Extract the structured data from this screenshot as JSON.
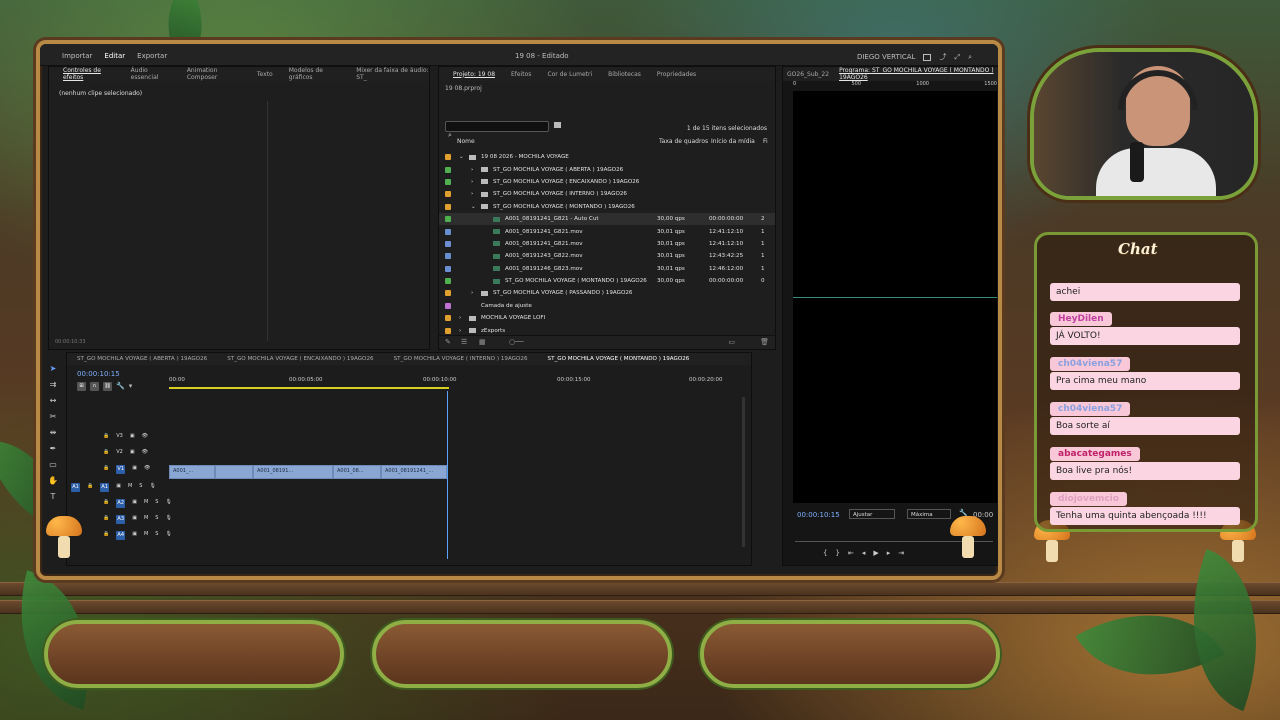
{
  "editor": {
    "menu": [
      "Importar",
      "Editar",
      "Exportar"
    ],
    "active_menu": "Editar",
    "title": "19 08 - Editado",
    "workspace": "DIEGO VERTICAL"
  },
  "effect_controls": {
    "tabs": [
      "Controles de efeitos",
      "Áudio essencial",
      "Animation Composer",
      "Texto",
      "Modelos de gráficos",
      "Mixer da faixa de áudio: ST_"
    ],
    "empty_text": "(nenhum clipe selecionado)",
    "timecode": "00:00:10:33"
  },
  "project": {
    "tabs": [
      "Projeto: 19 08",
      "Efeitos",
      "Cor de Lumetri",
      "Bibliotecas",
      "Propriedades"
    ],
    "file": "19 08.prproj",
    "count": "1 de 15 itens selecionados",
    "columns": [
      "Nome",
      "Taxa de quadros",
      "Início da mídia",
      "Fi"
    ],
    "rows": [
      {
        "name": "19 08 2026 - MOCHILA VOYAGE",
        "indent": 1,
        "kind": "folder-open",
        "color": "#e0a030",
        "fps": "",
        "start": "",
        "f": ""
      },
      {
        "name": "ST_GO MOCHILA VOYAGE ( ABERTA ) 19AGO26",
        "indent": 2,
        "kind": "folder",
        "color": "#50b050",
        "fps": "",
        "start": "",
        "f": ""
      },
      {
        "name": "ST_GO MOCHILA VOYAGE ( ENCAIXANDO ) 19AGO26",
        "indent": 2,
        "kind": "folder",
        "color": "#50b050",
        "fps": "",
        "start": "",
        "f": ""
      },
      {
        "name": "ST_GO MOCHILA VOYAGE ( INTERNO ) 19AGO26",
        "indent": 2,
        "kind": "folder",
        "color": "#e0a030",
        "fps": "",
        "start": "",
        "f": ""
      },
      {
        "name": "ST_GO MOCHILA VOYAGE ( MONTANDO ) 19AGO26",
        "indent": 2,
        "kind": "folder-open",
        "color": "#e0a030",
        "fps": "",
        "start": "",
        "f": ""
      },
      {
        "name": "A001_08191241_G821 - Auto Cut",
        "indent": 3,
        "kind": "seq",
        "color": "#50b050",
        "fps": "30,00 qps",
        "start": "00:00:00:00",
        "f": "2",
        "sel": true
      },
      {
        "name": "A001_08191241_G821.mov",
        "indent": 3,
        "kind": "clip",
        "color": "#6b8fd0",
        "fps": "30,01 qps",
        "start": "12:41:12:10",
        "f": "1"
      },
      {
        "name": "A001_08191241_G821.mov",
        "indent": 3,
        "kind": "clip",
        "color": "#6b8fd0",
        "fps": "30,01 qps",
        "start": "12:41:12:10",
        "f": "1"
      },
      {
        "name": "A001_08191243_G822.mov",
        "indent": 3,
        "kind": "clip",
        "color": "#6b8fd0",
        "fps": "30,01 qps",
        "start": "12:43:42:25",
        "f": "1"
      },
      {
        "name": "A001_08191246_G823.mov",
        "indent": 3,
        "kind": "clip",
        "color": "#6b8fd0",
        "fps": "30,01 qps",
        "start": "12:46:12:00",
        "f": "1"
      },
      {
        "name": "ST_GO MOCHILA VOYAGE ( MONTANDO ) 19AGO26",
        "indent": 3,
        "kind": "seq",
        "color": "#50b050",
        "fps": "30,00 qps",
        "start": "00:00:00:00",
        "f": "0"
      },
      {
        "name": "ST_GO MOCHILA VOYAGE ( PASSANDO ) 19AGO26",
        "indent": 2,
        "kind": "folder",
        "color": "#e0a030",
        "fps": "",
        "start": "",
        "f": ""
      },
      {
        "name": "Camada de ajuste",
        "indent": 1,
        "kind": "none",
        "color": "#c070d0",
        "fps": "",
        "start": "",
        "f": ""
      },
      {
        "name": "MOCHILA VOYAGE LOFI",
        "indent": 1,
        "kind": "folder",
        "color": "#e0a030",
        "fps": "",
        "start": "",
        "f": ""
      },
      {
        "name": "zExports",
        "indent": 1,
        "kind": "folder",
        "color": "#e0a030",
        "fps": "",
        "start": "",
        "f": ""
      }
    ]
  },
  "program": {
    "tabs": [
      "GO26_Sub_22",
      "Programa: ST_GO MOCHILA VOYAGE ( MONTANDO ) 19AGO26"
    ],
    "timecode": "00:00:10:15",
    "fit": "Ajustar",
    "quality": "Máxima",
    "end_timecode": "00:00",
    "ruler": [
      "0",
      "500",
      "1000",
      "1500"
    ]
  },
  "timeline": {
    "tabs": [
      "ST_GO MOCHILA VOYAGE ( ABERTA ) 19AGO26",
      "ST_GO MOCHILA VOYAGE ( ENCAIXANDO ) 19AGO26",
      "ST_GO MOCHILA VOYAGE ( INTERNO ) 19AGO26",
      "ST_GO MOCHILA VOYAGE ( MONTANDO ) 19AGO26"
    ],
    "timecode": "00:00:10:15",
    "ruler": [
      "00:00",
      "00:00:05:00",
      "00:00:10:00",
      "00:00:15:00",
      "00:00:20:00"
    ],
    "video_tracks": [
      "V3",
      "V2",
      "V1"
    ],
    "audio_tracks": [
      "A1",
      "A2",
      "A3",
      "A4"
    ],
    "clips": [
      "A001_...",
      "A001_08191...",
      "A001_08...",
      "A001_08191241_..."
    ]
  },
  "chat": {
    "title": "Chat",
    "messages": [
      {
        "user": "",
        "text": "achei",
        "user_color": "#000"
      },
      {
        "user": "HeyDilen",
        "text": "JÁ VOLTO!",
        "user_color": "#d050a0"
      },
      {
        "user": "ch04viena57",
        "text": "Pra cima meu mano",
        "user_color": "#8aa0e0"
      },
      {
        "user": "ch04viena57",
        "text": "Boa sorte aí",
        "user_color": "#8aa0e0"
      },
      {
        "user": "abacategames",
        "text": "Boa live pra nós!",
        "user_color": "#d02a80"
      },
      {
        "user": "diojovemcio",
        "text": "Tenha uma quinta abençoada !!!!",
        "user_color": "#e0a0c0"
      }
    ]
  }
}
